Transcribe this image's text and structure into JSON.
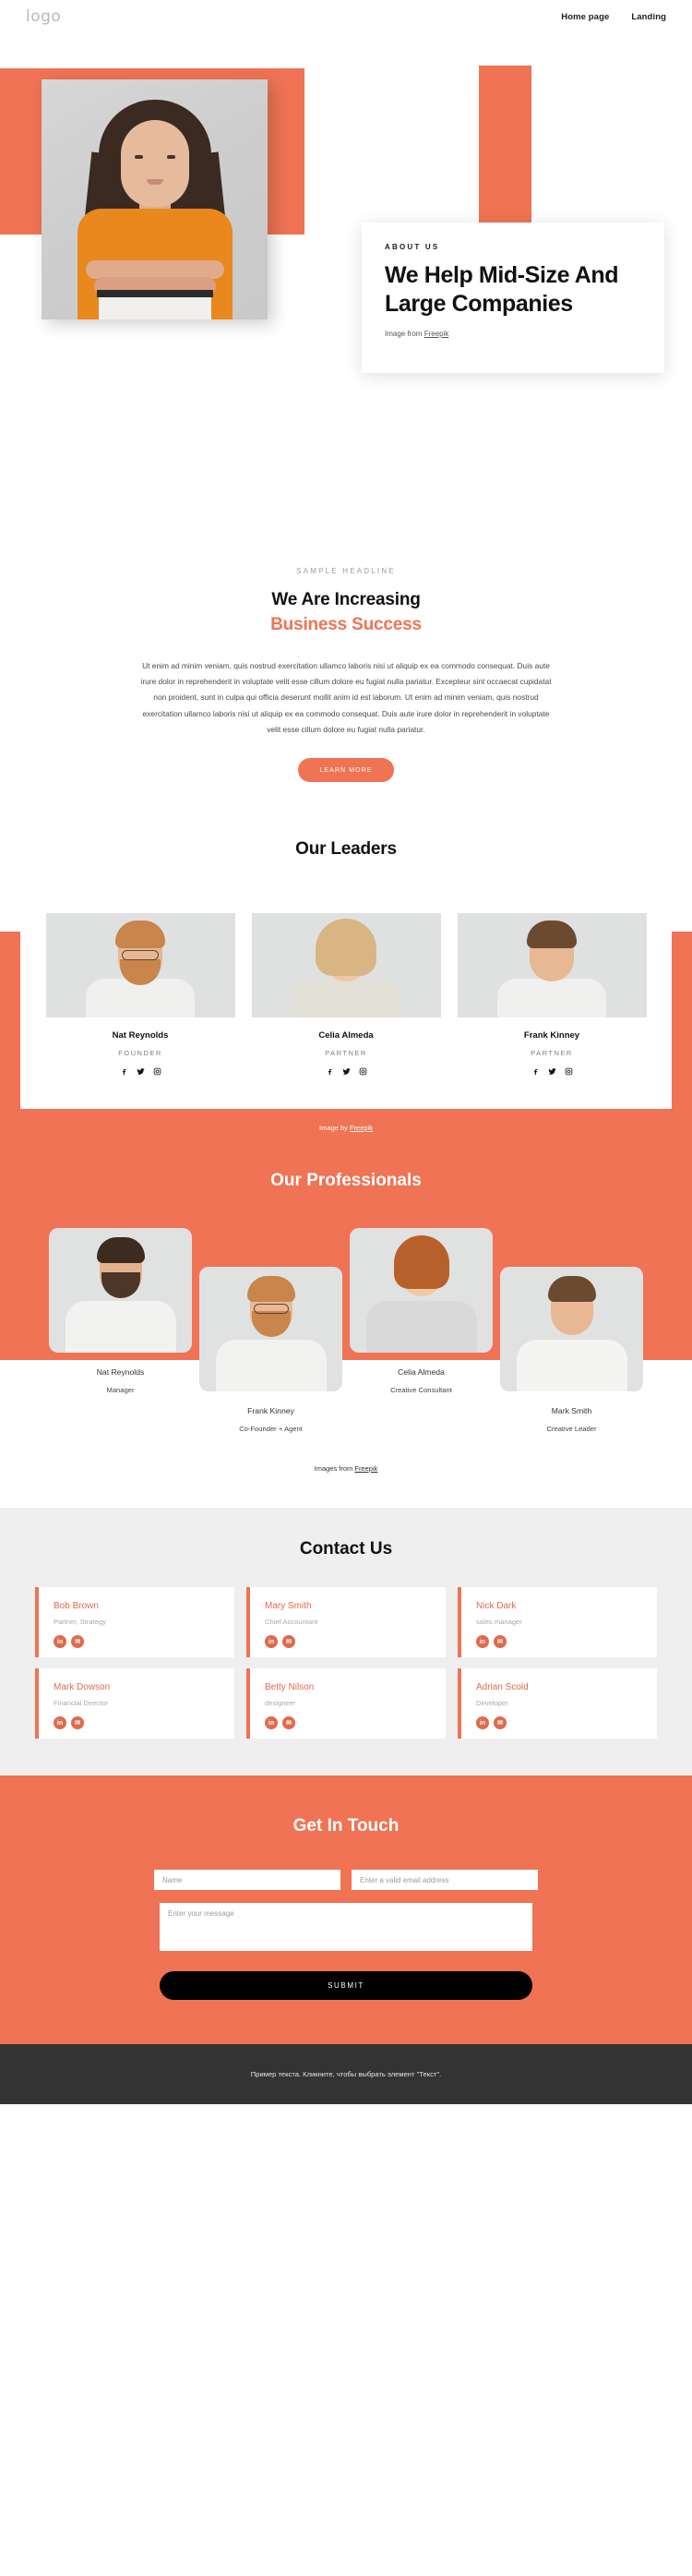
{
  "header": {
    "logo": "logo",
    "nav": [
      {
        "label": "Home page"
      },
      {
        "label": "Landing"
      }
    ]
  },
  "hero": {
    "eyebrow": "ABOUT US",
    "title": "We Help Mid-Size And Large Companies",
    "credit_prefix": "Image from ",
    "credit_link": "Freepik"
  },
  "increasing": {
    "sample_headline": "SAMPLE HEADLINE",
    "title_line1": "We Are Increasing",
    "title_line2": "Business Success",
    "body": "Ut enim ad minim veniam, quis nostrud exercitation ullamco laboris nisi ut aliquip ex ea commodo consequat. Duis aute irure dolor in reprehenderit in voluptate velit esse cillum dolore eu fugiat nulla pariatur. Excepteur sint occaecat cupidatat non proident, sunt in culpa qui officia deserunt mollit anim id est laborum. Ut enim ad minim veniam, quis nostrud exercitation ullamco laboris nisi ut aliquip ex ea commodo consequat. Duis aute irure dolor in reprehenderit in voluptate velit esse cillum dolore eu fugiat nulla pariatur.",
    "button": "LEARN MORE"
  },
  "leaders": {
    "title": "Our Leaders",
    "credit_prefix": "Image by ",
    "credit_link": "Freepik",
    "members": [
      {
        "name": "Nat Reynolds",
        "role": "FOUNDER"
      },
      {
        "name": "Celia Almeda",
        "role": "PARTNER"
      },
      {
        "name": "Frank Kinney",
        "role": "PARTNER"
      }
    ],
    "social_icons": [
      "facebook-icon",
      "twitter-icon",
      "instagram-icon"
    ],
    "social_glyphs": [
      "f",
      "\u0001",
      "□"
    ]
  },
  "professionals": {
    "title": "Our Professionals",
    "credit_prefix": "Images from ",
    "credit_link": "Freepik",
    "members": [
      {
        "name": "Nat Reynolds",
        "role": "Manager"
      },
      {
        "name": "Frank Kinney",
        "role": "Co-Founder + Agent"
      },
      {
        "name": "Celia Almeda",
        "role": "Creative Consultant"
      },
      {
        "name": "Mark Smith",
        "role": "Creative Leader"
      }
    ]
  },
  "contact": {
    "title": "Contact Us",
    "cards": [
      {
        "name": "Bob Brown",
        "role": "Partner, Strategy"
      },
      {
        "name": "Mary Smith",
        "role": "Chief Accountant"
      },
      {
        "name": "Nick Dark",
        "role": "sales manager"
      },
      {
        "name": "Mark Dowson",
        "role": "Financial Director"
      },
      {
        "name": "Betty Nilson",
        "role": "designeer"
      },
      {
        "name": "Adrian Scold",
        "role": "Developer"
      }
    ],
    "icon_linkedin": "in",
    "icon_email": "✉"
  },
  "get_in_touch": {
    "title": "Get In Touch",
    "name_placeholder": "Name",
    "email_placeholder": "Enter a valid email address",
    "message_placeholder": "Enter your message",
    "submit_label": "SUBMIT"
  },
  "footer": {
    "text": "Пример текста. Кликните, чтобы выбрать элемент \"Текст\"."
  },
  "colors": {
    "accent": "#ef7354",
    "contact_accent": "#e06a4d",
    "gray_bg": "#efefef",
    "footer_bg": "#333333"
  }
}
